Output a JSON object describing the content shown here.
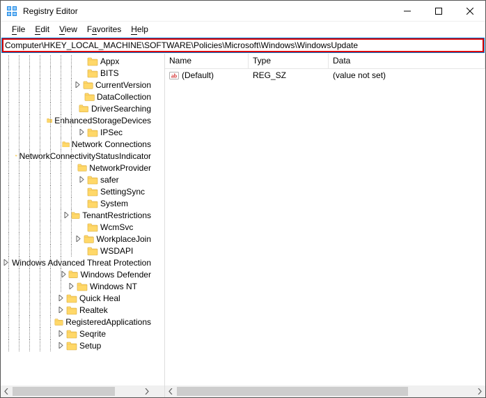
{
  "window": {
    "title": "Registry Editor"
  },
  "menu": {
    "file": "File",
    "edit": "Edit",
    "view": "View",
    "favorites": "Favorites",
    "help": "Help"
  },
  "address": {
    "path": "Computer\\HKEY_LOCAL_MACHINE\\SOFTWARE\\Policies\\Microsoft\\Windows\\WindowsUpdate"
  },
  "columns": {
    "name": "Name",
    "type": "Type",
    "data": "Data"
  },
  "values": [
    {
      "name": "(Default)",
      "type": "REG_SZ",
      "data": "(value not set)"
    }
  ],
  "tree": [
    {
      "depth": 7,
      "expander": "none",
      "label": "Appx"
    },
    {
      "depth": 7,
      "expander": "none",
      "label": "BITS"
    },
    {
      "depth": 7,
      "expander": "closed",
      "label": "CurrentVersion"
    },
    {
      "depth": 7,
      "expander": "none",
      "label": "DataCollection"
    },
    {
      "depth": 7,
      "expander": "none",
      "label": "DriverSearching"
    },
    {
      "depth": 7,
      "expander": "none",
      "label": "EnhancedStorageDevices"
    },
    {
      "depth": 7,
      "expander": "closed",
      "label": "IPSec"
    },
    {
      "depth": 7,
      "expander": "none",
      "label": "Network Connections"
    },
    {
      "depth": 7,
      "expander": "none",
      "label": "NetworkConnectivityStatusIndicator"
    },
    {
      "depth": 7,
      "expander": "none",
      "label": "NetworkProvider"
    },
    {
      "depth": 7,
      "expander": "closed",
      "label": "safer"
    },
    {
      "depth": 7,
      "expander": "none",
      "label": "SettingSync"
    },
    {
      "depth": 7,
      "expander": "none",
      "label": "System"
    },
    {
      "depth": 7,
      "expander": "closed",
      "label": "TenantRestrictions"
    },
    {
      "depth": 7,
      "expander": "none",
      "label": "WcmSvc"
    },
    {
      "depth": 7,
      "expander": "closed",
      "label": "WorkplaceJoin"
    },
    {
      "depth": 7,
      "expander": "none",
      "label": "WSDAPI"
    },
    {
      "depth": 6,
      "expander": "closed",
      "label": "Windows Advanced Threat Protection"
    },
    {
      "depth": 6,
      "expander": "closed",
      "label": "Windows Defender"
    },
    {
      "depth": 6,
      "expander": "closed",
      "label": "Windows NT"
    },
    {
      "depth": 5,
      "expander": "closed",
      "label": "Quick Heal"
    },
    {
      "depth": 5,
      "expander": "closed",
      "label": "Realtek"
    },
    {
      "depth": 5,
      "expander": "none",
      "label": "RegisteredApplications"
    },
    {
      "depth": 5,
      "expander": "closed",
      "label": "Seqrite"
    },
    {
      "depth": 5,
      "expander": "closed",
      "label": "Setup"
    }
  ]
}
